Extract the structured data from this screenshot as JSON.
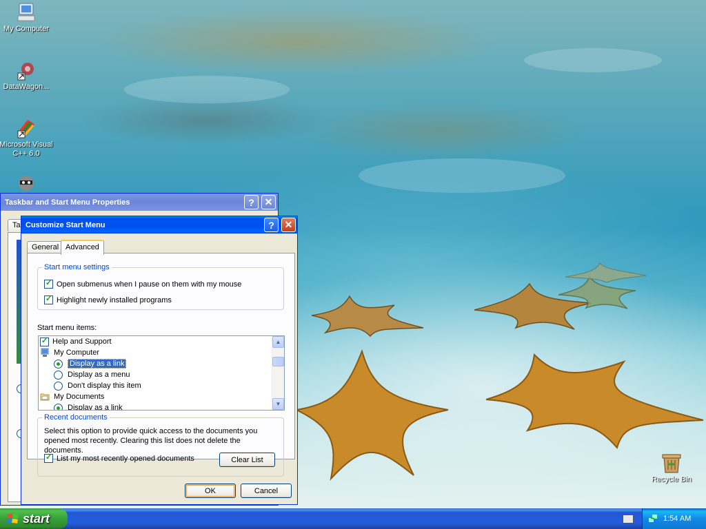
{
  "desktop": {
    "icons": [
      {
        "label": "My Computer"
      },
      {
        "label": "DataWagon..."
      },
      {
        "label": "Microsoft Visual C++ 6.0"
      },
      {
        "label": "Recycle Bin"
      }
    ]
  },
  "back_window": {
    "title": "Taskbar and Start Menu Properties",
    "help_label": "?",
    "close_label": "✕",
    "tab_fragment": "Ta"
  },
  "dialog": {
    "title": "Customize Start Menu",
    "help_label": "?",
    "close_label": "✕",
    "tabs": [
      {
        "label": "General",
        "active": false
      },
      {
        "label": "Advanced",
        "active": true
      }
    ],
    "start_menu_settings": {
      "legend": "Start menu settings",
      "options": [
        {
          "label": "Open submenus when I pause on them with my mouse",
          "checked": true
        },
        {
          "label": "Highlight newly installed programs",
          "checked": true
        }
      ]
    },
    "start_menu_items": {
      "label": "Start menu items:",
      "items": [
        {
          "kind": "checkbox",
          "label": "Help and Support",
          "checked": true
        },
        {
          "kind": "header",
          "label": "My Computer",
          "icon": "computer-icon"
        },
        {
          "kind": "radio",
          "label": "Display as a link",
          "checked": true,
          "selected": true
        },
        {
          "kind": "radio",
          "label": "Display as a menu",
          "checked": false
        },
        {
          "kind": "radio",
          "label": "Don't display this item",
          "checked": false
        },
        {
          "kind": "header",
          "label": "My Documents",
          "icon": "folder-icon"
        },
        {
          "kind": "radio",
          "label": "Display as a link",
          "checked": true
        }
      ]
    },
    "recent_documents": {
      "legend": "Recent documents",
      "description": "Select this option to provide quick access to the documents you opened most recently.  Clearing this list does not delete the documents.",
      "list_recent_label": "List my most recently opened documents",
      "list_recent_checked": true,
      "clear_list_label": "Clear List"
    },
    "ok_label": "OK",
    "cancel_label": "Cancel"
  },
  "taskbar": {
    "start_label": "start",
    "clock": "1:54 AM"
  },
  "colors": {
    "title_blue": "#0053ee",
    "legend_blue": "#0046d5",
    "check_green": "#21a121",
    "selection": "#316ac5"
  }
}
